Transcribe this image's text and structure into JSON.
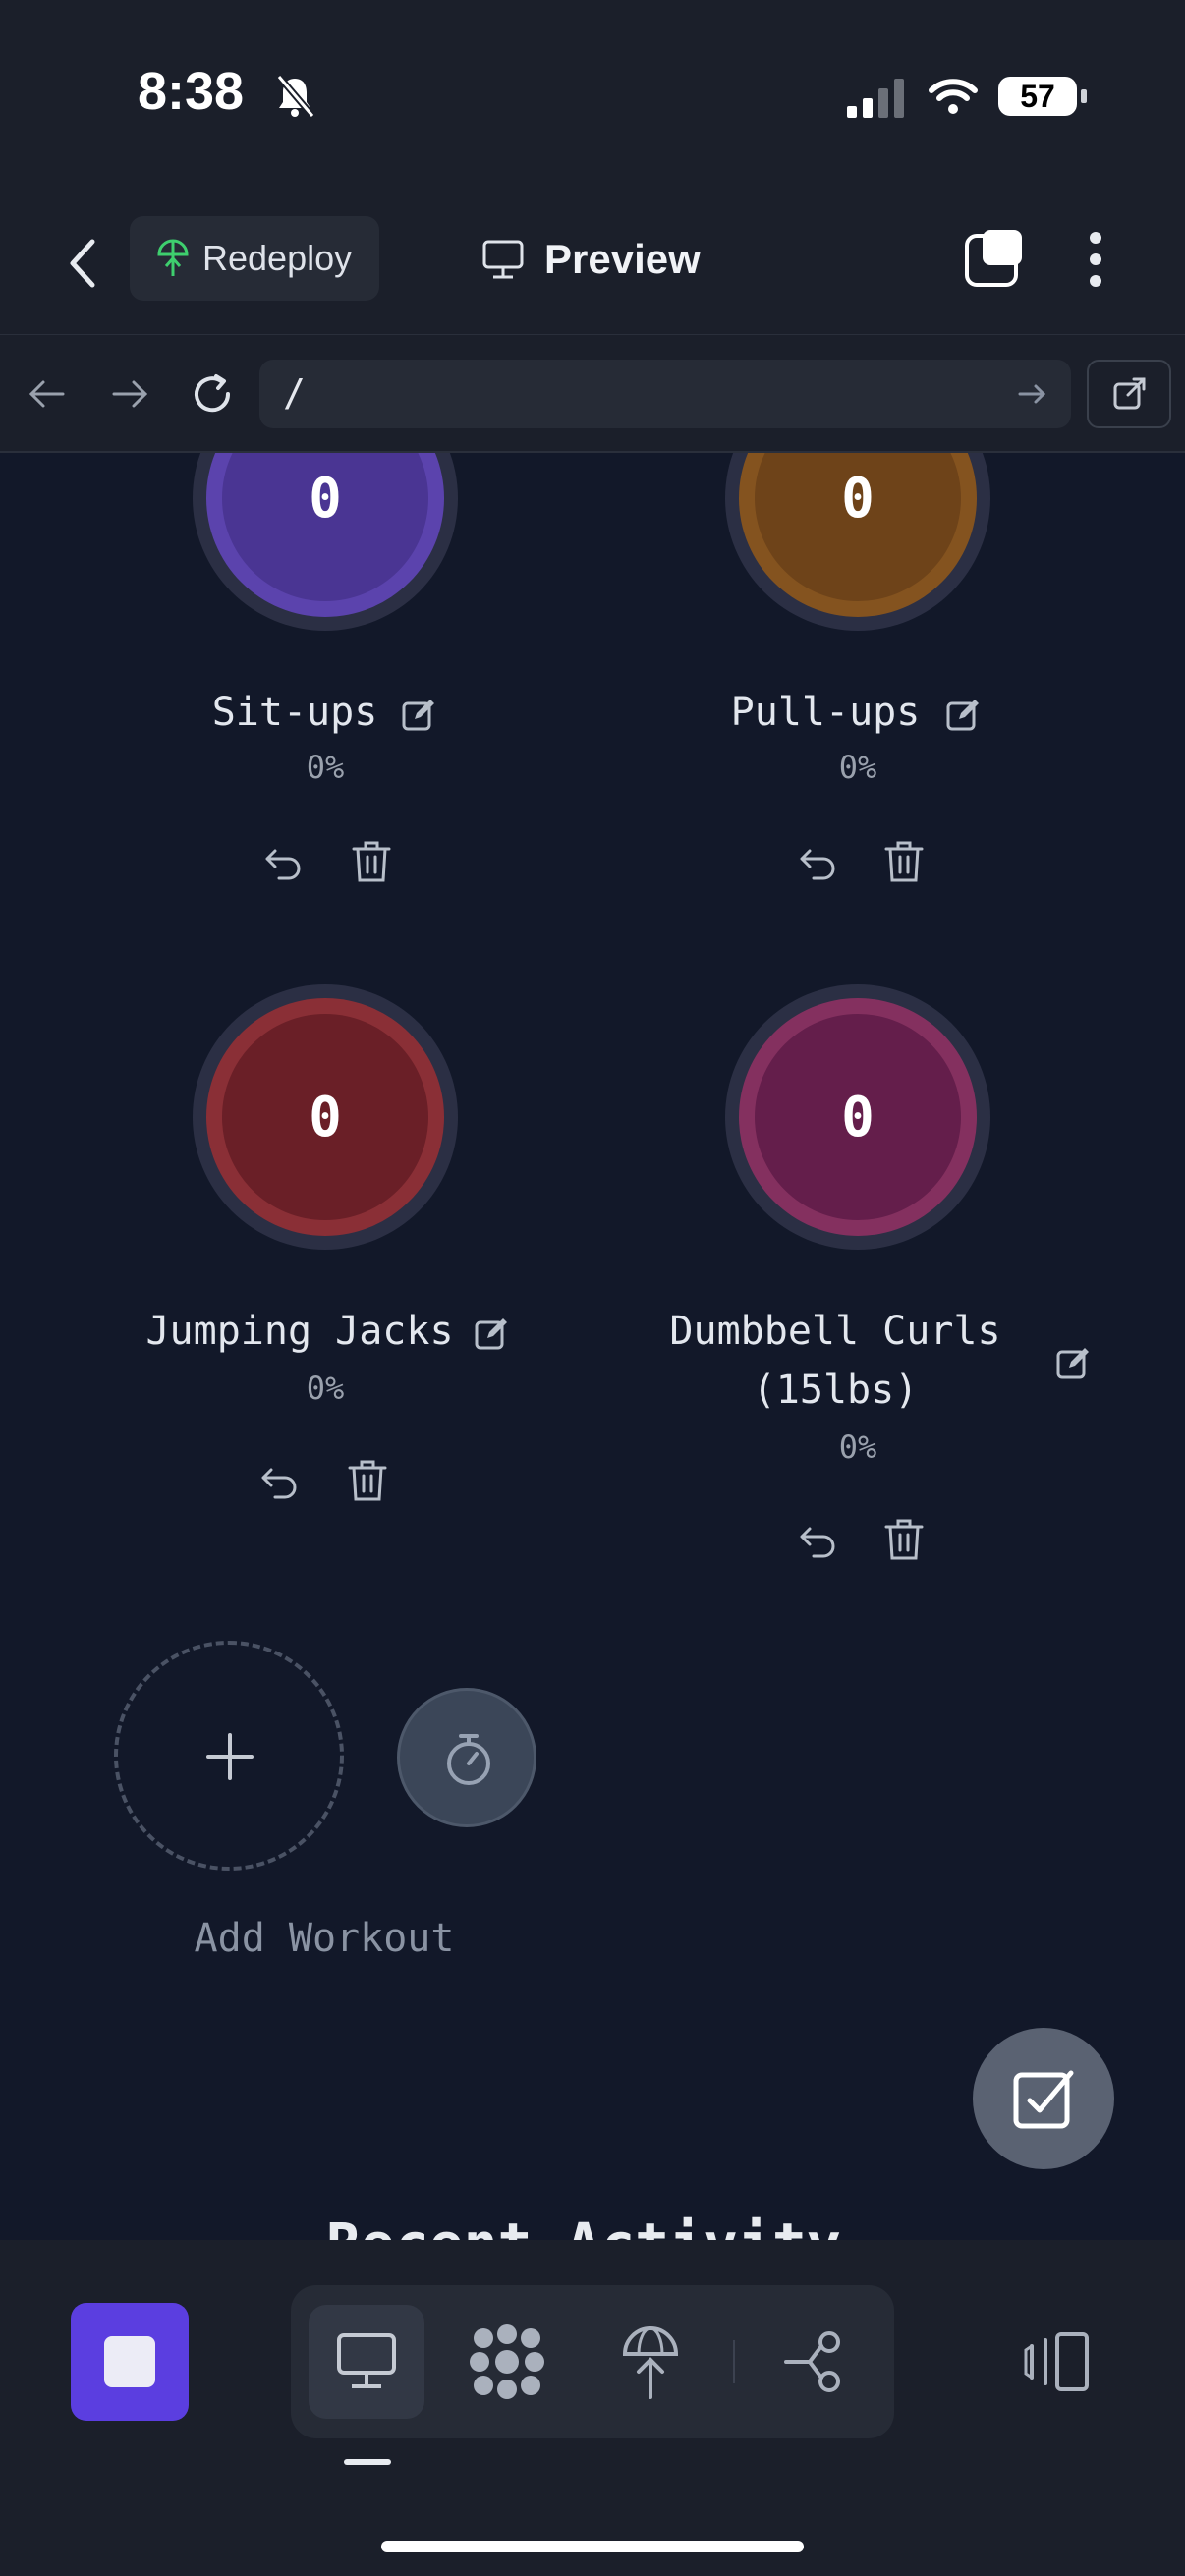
{
  "status_bar": {
    "time": "8:38",
    "battery": "57"
  },
  "app_header": {
    "redeploy_label": "Redeploy",
    "title": "Preview"
  },
  "url_bar": {
    "url": "/"
  },
  "workouts": [
    {
      "name": "Sit-ups",
      "count": "0",
      "percent": "0%",
      "color": "#4a3593",
      "ring": "#5b43ad"
    },
    {
      "name": "Pull-ups",
      "count": "0",
      "percent": "0%",
      "color": "#6e4319",
      "ring": "#84531f"
    },
    {
      "name": "Jumping Jacks",
      "count": "0",
      "percent": "0%",
      "color": "#6a1f27",
      "ring": "#8a2f36"
    },
    {
      "name": "Dumbbell Curls",
      "name_line2": "(15lbs)",
      "count": "0",
      "percent": "0%",
      "color": "#641e4b",
      "ring": "#84305f"
    }
  ],
  "add_workout": {
    "label": "Add Workout"
  },
  "section": {
    "recent_activity": "Recent Activity"
  },
  "colors": {
    "background": "#121829",
    "bar": "#1b1f2a",
    "accent": "#5b3ee0",
    "green": "#3ecf6e"
  }
}
